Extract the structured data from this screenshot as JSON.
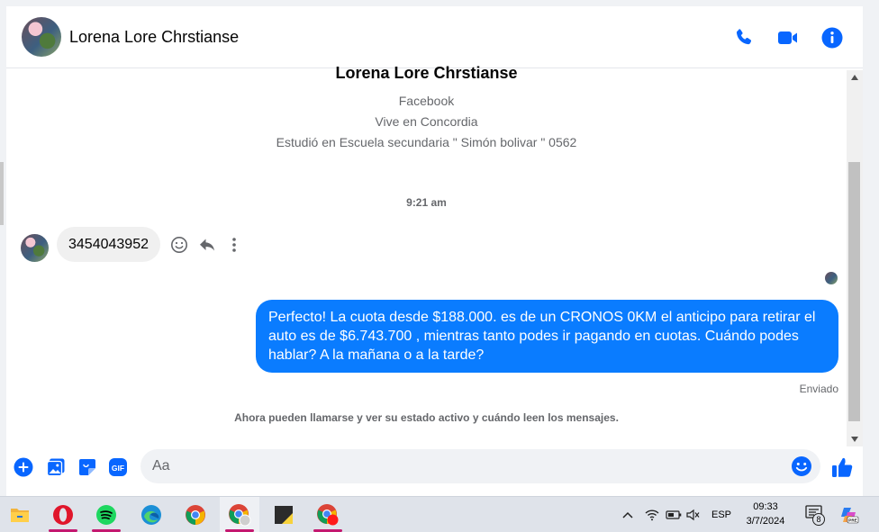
{
  "header": {
    "contact_name": "Lorena Lore Chrstianse"
  },
  "profile": {
    "name": "Lorena Lore Chrstianse",
    "source": "Facebook",
    "lives": "Vive en Concordia",
    "studied": "Estudió en Escuela secundaria \" Simón bolivar \" 0562"
  },
  "chat": {
    "timestamp": "9:21 am",
    "incoming_message": "3454043952",
    "outgoing_message": "Perfecto! La cuota desde $188.000. es de un CRONOS 0KM el anticipo para retirar el auto es de $6.743.700 , mientras tanto podes ir pagando en cuotas. Cuándo podes hablar? A la mañana o a la tarde?",
    "sent_status": "Enviado",
    "notice": "Ahora pueden llamarse y ver su estado activo y cuándo leen los mensajes."
  },
  "composer": {
    "placeholder": "Aa"
  },
  "taskbar": {
    "language": "ESP",
    "time": "09:33",
    "date": "3/7/2024",
    "notification_count": "8"
  },
  "colors": {
    "accent": "#0a7cff",
    "icon_blue": "#0866ff"
  }
}
